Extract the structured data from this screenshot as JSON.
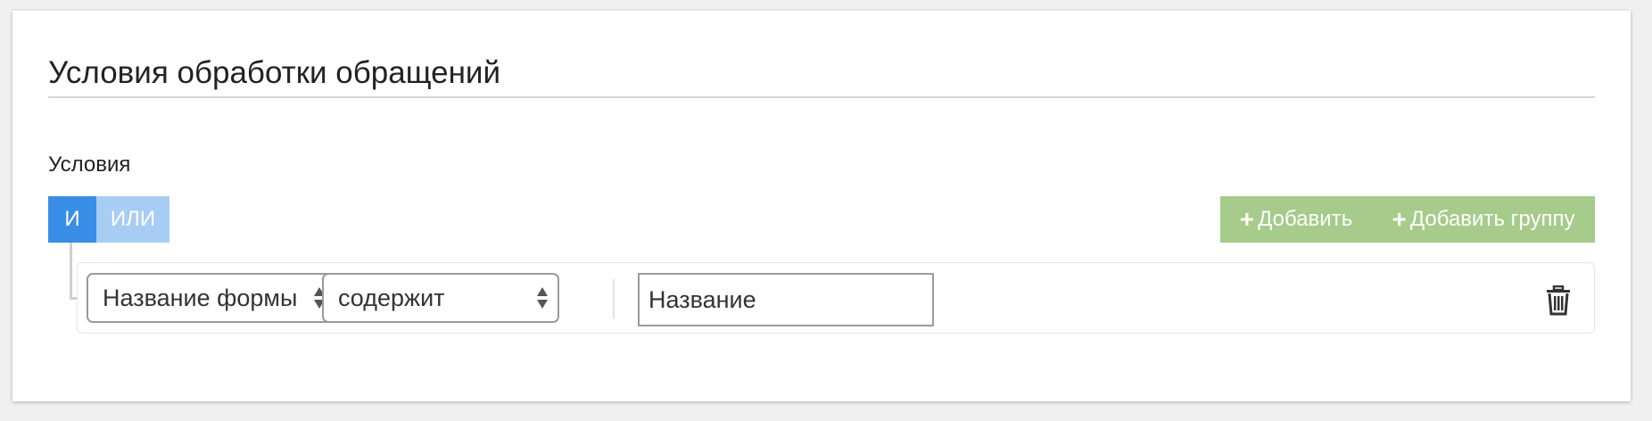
{
  "panel": {
    "title": "Условия обработки обращений",
    "section_label": "Условия"
  },
  "logic": {
    "and_label": "И",
    "or_label": "ИЛИ"
  },
  "actions": {
    "add_label": "Добавить",
    "add_group_label": "Добавить группу",
    "plus_glyph": "+"
  },
  "rule": {
    "field_value": "Название формы",
    "operator_value": "содержит",
    "value_text": "Название"
  },
  "icons": {
    "sort": "sort-icon",
    "delete": "trash-icon",
    "plus": "plus-icon"
  },
  "colors": {
    "and_active": "#3a8ee6",
    "or_inactive": "#a7cdf4",
    "add_button": "#a6cb8a"
  }
}
